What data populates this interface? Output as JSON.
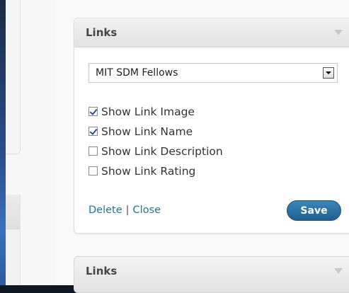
{
  "widget_primary": {
    "title": "Links",
    "category_select": {
      "value": "MIT SDM Fellows"
    },
    "options": [
      {
        "label": "Show Link Image",
        "checked": true
      },
      {
        "label": "Show Link Name",
        "checked": true
      },
      {
        "label": "Show Link Description",
        "checked": false
      },
      {
        "label": "Show Link Rating",
        "checked": false
      }
    ],
    "delete_label": "Delete",
    "separator": "|",
    "close_label": "Close",
    "save_label": "Save"
  },
  "widget_secondary": {
    "title": "Links"
  },
  "colors": {
    "link": "#21759b",
    "save_button": "#2a6fa3"
  }
}
